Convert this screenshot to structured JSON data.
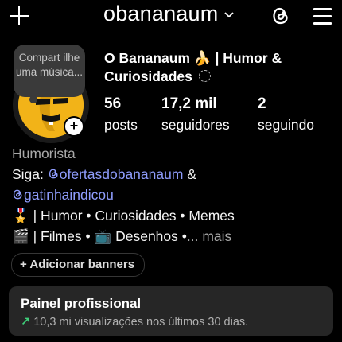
{
  "header": {
    "username": "obananaum"
  },
  "note": {
    "text": "Compart ilhe uma música..."
  },
  "profile": {
    "display_name": "O Bananaum 🍌 | Humor & Curiosidades"
  },
  "stats": [
    {
      "value": "56",
      "label": "posts"
    },
    {
      "value": "17,2 mil",
      "label": "seguidores"
    },
    {
      "value": "2",
      "label": "seguindo"
    }
  ],
  "bio": {
    "category": "Humorista",
    "follow_prefix": "Siga: ",
    "link1": "ofertasdobananaum",
    "amp": " &",
    "link2": "gatinhaindicou",
    "line3": "🎖️ | Humor • Curiosidades • Memes",
    "line4": "🎬 | Filmes • 📺 Desenhos •",
    "more": "... mais"
  },
  "banners": {
    "label": "+ Adicionar banners"
  },
  "panel": {
    "title": "Painel profissional",
    "trend_arrow": "↗",
    "subtitle": "10,3 mi visualizações nos últimos 30 dias."
  }
}
